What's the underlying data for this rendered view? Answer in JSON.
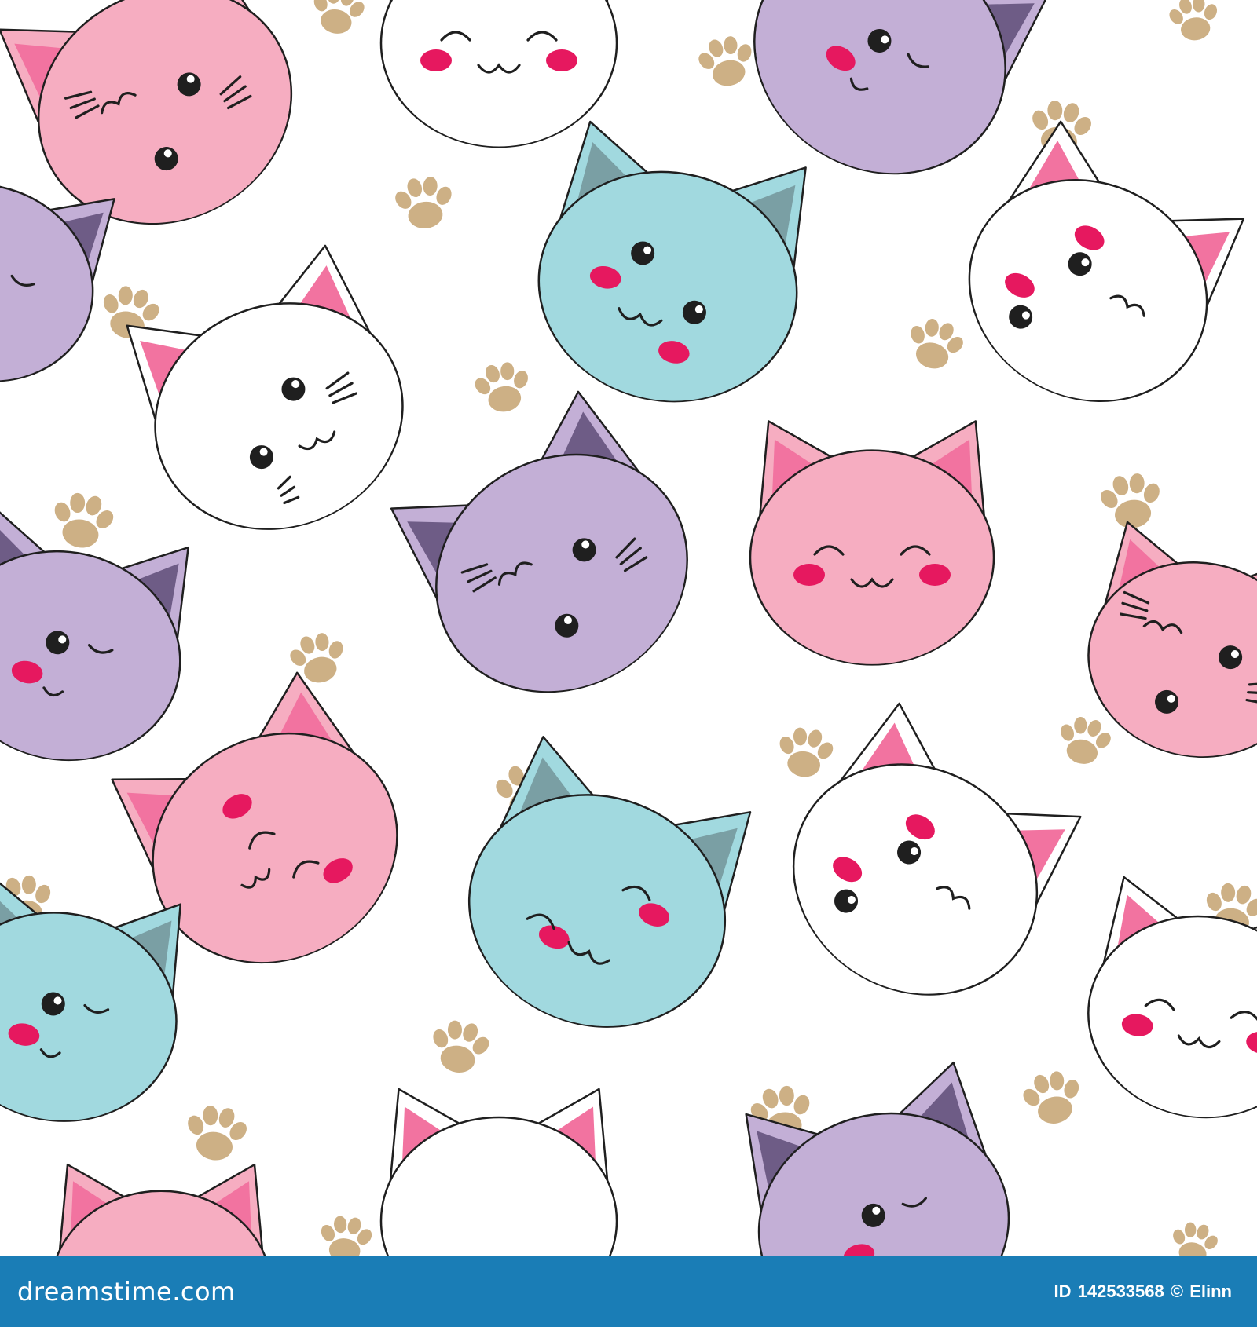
{
  "image": {
    "subject": "seamless pattern of kawaii cat faces and paw prints",
    "background_color": "#ffffff"
  },
  "palette": {
    "pink": "#f6adc1",
    "purple": "#c3afd6",
    "blue": "#a1d9df",
    "white": "#ffffff",
    "outline": "#1f1f1f",
    "pink_inner_ear": "#f273a0",
    "purple_inner_ear": "#6e5c86",
    "blue_inner_ear": "#7a9fa4",
    "blush": "#e6185f",
    "paw": "#cdb085"
  },
  "cats": [
    {
      "color": "pink",
      "face": "squint-left"
    },
    {
      "color": "white",
      "face": "closed-happy"
    },
    {
      "color": "purple",
      "face": "wink"
    },
    {
      "color": "blue",
      "face": "smile-eyes"
    },
    {
      "color": "white",
      "face": "eyes-whiskers"
    },
    {
      "color": "white",
      "face": "blush-eyes"
    },
    {
      "color": "purple",
      "face": "squint-left"
    },
    {
      "color": "pink",
      "face": "closed-happy"
    },
    {
      "color": "purple",
      "face": "wink"
    },
    {
      "color": "pink",
      "face": "sleepy"
    },
    {
      "color": "blue",
      "face": "wink-smile"
    },
    {
      "color": "white",
      "face": "blush-eyes"
    },
    {
      "color": "blue",
      "face": "wink"
    },
    {
      "color": "white",
      "face": "ears-only"
    },
    {
      "color": "purple",
      "face": "wink"
    },
    {
      "color": "pink",
      "face": "ears-only"
    }
  ],
  "footer": {
    "background": "#1a7db6",
    "logo_text": "dreamstime.com",
    "id_label": "ID",
    "id_number": "142533568",
    "copyright_symbol": "©",
    "author": "Elinn"
  }
}
